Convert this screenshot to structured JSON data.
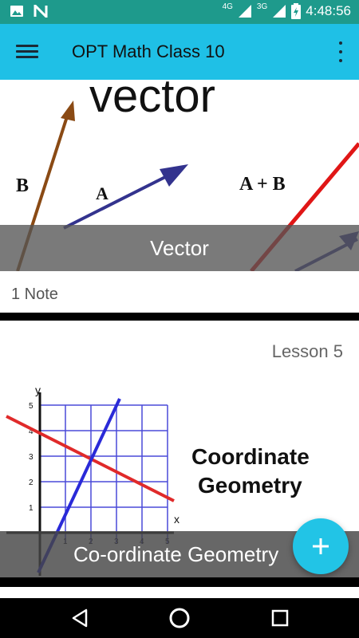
{
  "status_bar": {
    "time": "4:48:56",
    "network_left": "4G",
    "network_right": "3G",
    "icons": [
      "image-icon",
      "n-icon",
      "signal-icon",
      "battery-charging-icon"
    ]
  },
  "app_bar": {
    "title": "OPT Math Class 10",
    "menu_icon": "hamburger-menu-icon",
    "more_icon": "more-vert-icon"
  },
  "cards": [
    {
      "image_heading": "vector",
      "image_labels": [
        "B",
        "A",
        "A + B"
      ],
      "title": "Vector",
      "note_count": "1 Note"
    },
    {
      "lesson": "Lesson 5",
      "image_text_line1": "Coordinate",
      "image_text_line2": "Geometry",
      "title": "Co-ordinate Geometry",
      "axis_y": "y",
      "axis_x": "x",
      "y_ticks": [
        "5",
        "4",
        "3",
        "2",
        "1"
      ],
      "x_ticks": [
        "1",
        "2",
        "3",
        "4",
        "5"
      ]
    }
  ],
  "fab": {
    "label": "+"
  },
  "nav": {
    "back_icon": "back-triangle-icon",
    "home_icon": "home-circle-icon",
    "recent_icon": "recent-square-icon"
  }
}
